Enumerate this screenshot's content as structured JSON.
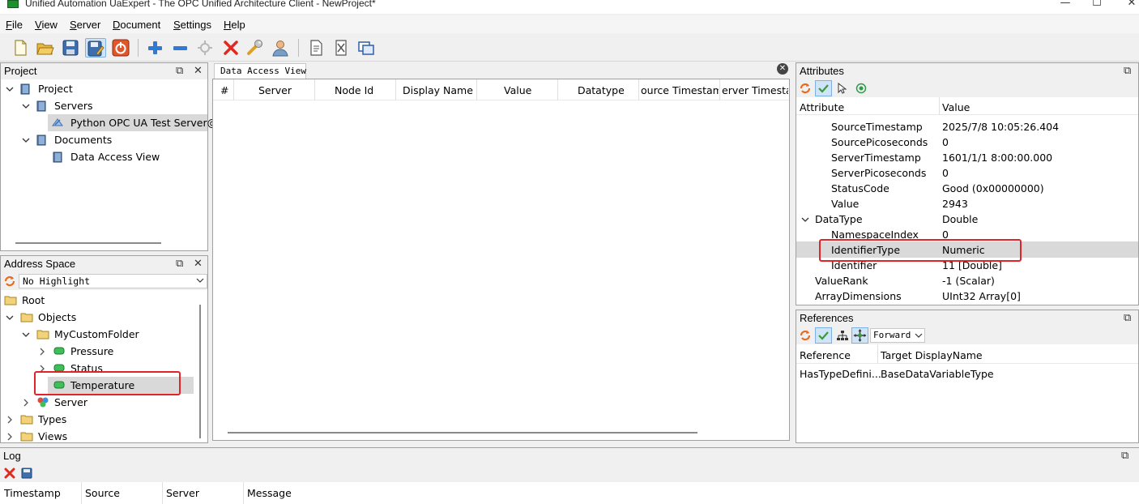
{
  "window": {
    "title": "Unified Automation UaExpert - The OPC Unified Architecture Client - NewProject*",
    "minimize": "—",
    "maximize": "☐",
    "close": "✕"
  },
  "menu": [
    {
      "label": "File",
      "ul": "F",
      "rest": "ile"
    },
    {
      "label": "View",
      "ul": "V",
      "rest": "iew"
    },
    {
      "label": "Server",
      "ul": "S",
      "rest": "erver"
    },
    {
      "label": "Document",
      "ul": "D",
      "rest": "ocument"
    },
    {
      "label": "Settings",
      "ul": "S",
      "rest": "ettings"
    },
    {
      "label": "Help",
      "ul": "H",
      "rest": "elp"
    }
  ],
  "project": {
    "title": "Project",
    "float": "⧉",
    "close": "✕",
    "tree": {
      "root": "Project",
      "servers": "Servers",
      "server_item": "Python OPC UA Test Server@",
      "documents": "Documents",
      "doc_item": "Data Access View"
    }
  },
  "address_space": {
    "title": "Address Space",
    "float": "⧉",
    "close": "✕",
    "highlight": "No Highlight",
    "tree": {
      "root": "Root",
      "objects": "Objects",
      "folder": "MyCustomFolder",
      "pressure": "Pressure",
      "status": "Status",
      "temperature": "Temperature",
      "server": "Server",
      "types": "Types",
      "views": "Views"
    }
  },
  "dav": {
    "tab": "Data Access View",
    "close": "✕",
    "columns": [
      "#",
      "Server",
      "Node Id",
      "Display Name",
      "Value",
      "Datatype",
      "ource Timestam",
      "erver Timesta"
    ]
  },
  "attributes": {
    "title": "Attributes",
    "float": "⧉",
    "headers": {
      "attribute": "Attribute",
      "value": "Value"
    },
    "rows": [
      {
        "name": "SourceTimestamp",
        "value": "2025/7/8 10:05:26.404"
      },
      {
        "name": "SourcePicoseconds",
        "value": "0"
      },
      {
        "name": "ServerTimestamp",
        "value": "1601/1/1 8:00:00.000"
      },
      {
        "name": "ServerPicoseconds",
        "value": "0"
      },
      {
        "name": "StatusCode",
        "value": "Good (0x00000000)"
      },
      {
        "name": "Value",
        "value": "2943"
      },
      {
        "name": "DataType",
        "value": "Double"
      },
      {
        "name": "NamespaceIndex",
        "value": "0"
      },
      {
        "name": "IdentifierType",
        "value": "Numeric"
      },
      {
        "name": "Identifier",
        "value": "11 [Double]"
      },
      {
        "name": "ValueRank",
        "value": "-1 (Scalar)"
      },
      {
        "name": "ArrayDimensions",
        "value": "UInt32 Array[0]"
      }
    ]
  },
  "references": {
    "title": "References",
    "float": "⧉",
    "direction": "Forward",
    "headers": {
      "reference": "Reference",
      "target": "Target DisplayName"
    },
    "rows": [
      {
        "reference": "HasTypeDefini...",
        "target": "BaseDataVariableType"
      }
    ]
  },
  "log": {
    "title": "Log",
    "float": "⧉",
    "columns": [
      "Timestamp",
      "Source",
      "Server",
      "Message"
    ]
  },
  "colors": {
    "highlight_red": "#e0242a",
    "selection": "#d9d9d9"
  }
}
